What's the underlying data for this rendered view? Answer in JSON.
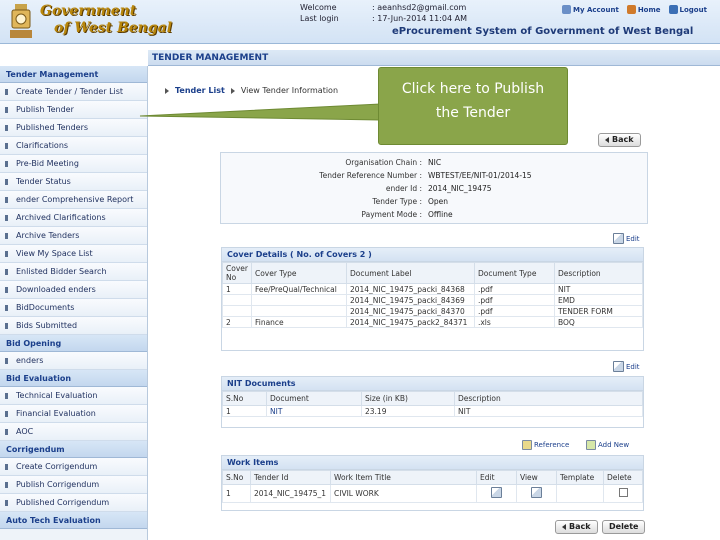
{
  "header": {
    "logo_line1": "Government",
    "logo_line2": "of West Bengal",
    "welcome_label": "Welcome",
    "welcome_value": ": aeanhsd2@gmail.com",
    "last_login_label": "Last login",
    "last_login_value": ": 17-Jun-2014 11:04 AM",
    "my_account": "My Account",
    "home": "Home",
    "logout": "Logout",
    "system_title": "eProcurement System of Government of West Bengal"
  },
  "sidebar": {
    "tender_mgmt_head": "Tender Management",
    "tender_items": [
      "Create Tender / Tender List",
      "Publish Tender",
      "Published Tenders",
      "Clarifications",
      "Pre-Bid Meeting",
      "Tender Status",
      " ender Comprehensive Report",
      "Archived Clarifications",
      "Archive Tenders",
      "View My Space List",
      "Enlisted Bidder Search",
      "Downloaded  enders",
      "BidDocuments",
      "Bids Submitted"
    ],
    "bid_opening_head": "Bid Opening",
    "bid_opening_items": [
      " enders"
    ],
    "bid_eval_head": "Bid Evaluation",
    "bid_eval_items": [
      "Technical Evaluation",
      "Financial Evaluation",
      "AOC"
    ],
    "corrigendum_head": "Corrigendum",
    "corrigendum_items": [
      "Create Corrigendum",
      "Publish Corrigendum",
      "Published Corrigendum"
    ],
    "auto_tech_head": "Auto Tech Evaluation"
  },
  "main": {
    "panel_title": "TENDER MANAGEMENT",
    "breadcrumb_link": "Tender List",
    "breadcrumb_current": "View Tender Information",
    "callout_line1": "Click here to Publish",
    "callout_line2": "the Tender",
    "back_label": "Back",
    "delete_label": "Delete"
  },
  "info": {
    "rows": [
      {
        "k": "Organisation Chain :",
        "v": "NIC"
      },
      {
        "k": "Tender Reference Number :",
        "v": "WBTEST/EE/NIT-01/2014-15"
      },
      {
        "k": "ender Id :",
        "v": "2014_NIC_19475"
      },
      {
        "k": "Tender Type :",
        "v": "Open"
      },
      {
        "k": "Payment Mode :",
        "v": "Offline"
      }
    ]
  },
  "covers": {
    "title": "Cover Details ( No. of Covers 2 )",
    "edit_label": "Edit",
    "headers": [
      "Cover No",
      "Cover Type",
      "Document Label",
      "Document Type",
      "Description"
    ],
    "rows": [
      [
        "1",
        "Fee/PreQual/Technical",
        "2014_NIC_19475_packi_84368",
        ".pdf",
        "NIT"
      ],
      [
        "",
        "",
        "2014_NIC_19475_packi_84369",
        ".pdf",
        "EMD"
      ],
      [
        "",
        "",
        "2014_NIC_19475_packi_84370",
        ".pdf",
        "TENDER FORM"
      ],
      [
        "2",
        "Finance",
        "2014_NIC_19475_pack2_84371",
        ".xls",
        "BOQ"
      ]
    ]
  },
  "nit": {
    "title": "NIT Documents",
    "edit_label": "Edit",
    "headers": [
      "S.No",
      "Document",
      "Size (in KB)",
      "Description"
    ],
    "rows": [
      [
        "1",
        "NIT",
        "23.19",
        "NIT"
      ]
    ]
  },
  "work": {
    "title": "Work Items",
    "reference_label": "Reference",
    "add_new_label": "Add New",
    "headers": [
      "S.No",
      "Tender Id",
      "Work Item Title",
      "Edit",
      "View",
      "Template",
      "Delete"
    ],
    "rows": [
      [
        "1",
        "2014_NIC_19475_1",
        "CIVIL WORK"
      ]
    ]
  }
}
